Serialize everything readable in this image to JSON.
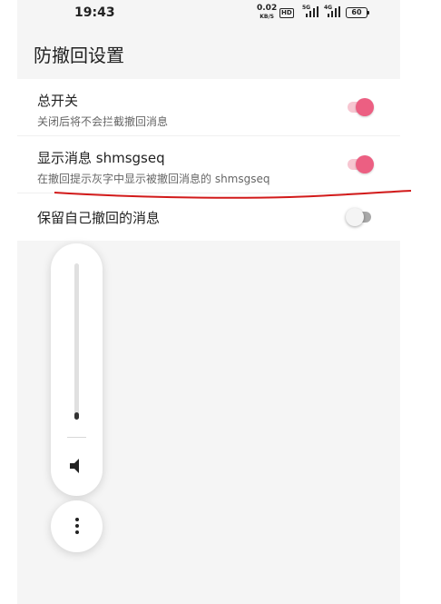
{
  "status_bar": {
    "time": "19:43",
    "net_speed": "0.02",
    "net_unit": "KB/S",
    "hd_badge": "HD",
    "sim1_label": "5G",
    "sim2_label": "4G",
    "battery": "60"
  },
  "page": {
    "title": "防撤回设置"
  },
  "settings": [
    {
      "title": "总开关",
      "subtitle": "关闭后将不会拦截撤回消息",
      "enabled": true
    },
    {
      "title": "显示消息 shmsgseq",
      "subtitle": "在撤回提示灰字中显示被撤回消息的 shmsgseq",
      "enabled": true
    },
    {
      "title": "保留自己撤回的消息",
      "enabled": false
    }
  ],
  "volume_overlay": {
    "level": 0.04,
    "speaker_icon": "speaker-icon",
    "more_icon": "more-vertical-icon"
  },
  "colors": {
    "toggle_on": "#ec5f82",
    "toggle_on_track": "#f7c6d1",
    "annotation_line": "#d21a1a"
  }
}
